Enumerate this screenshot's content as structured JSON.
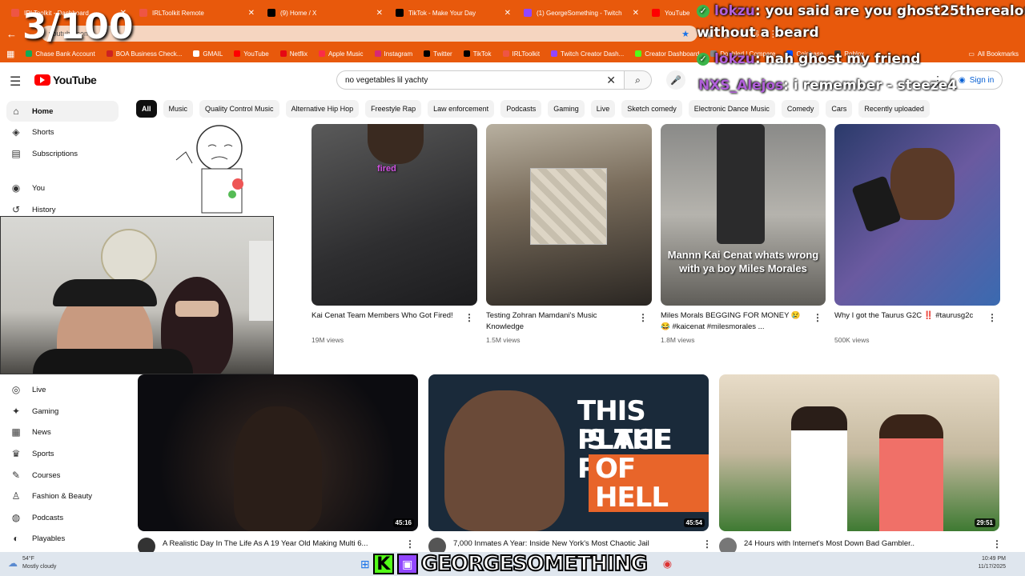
{
  "overlay": {
    "counter": "3/100"
  },
  "tabs": [
    {
      "label": "IRLToolkit - Dashboard",
      "color": "#e54"
    },
    {
      "label": "IRLToolkit Remote",
      "color": "#e54"
    },
    {
      "label": "(9) Home / X",
      "color": "#000"
    },
    {
      "label": "TikTok - Make Your Day",
      "color": "#000"
    },
    {
      "label": "(1) GeorgeSomething - Twitch",
      "color": "#9146ff"
    },
    {
      "label": "YouTube",
      "color": "#f00"
    }
  ],
  "address": {
    "url": "youtube.com"
  },
  "bookmarks": [
    {
      "label": "Chase Bank Account",
      "color": "#1a5"
    },
    {
      "label": "BOA Business Check...",
      "color": "#c22"
    },
    {
      "label": "GMAIL",
      "color": "#fff"
    },
    {
      "label": "YouTube",
      "color": "#f00"
    },
    {
      "label": "Netflix",
      "color": "#e50914"
    },
    {
      "label": "Apple Music",
      "color": "#fa2d48"
    },
    {
      "label": "Instagram",
      "color": "#d62976"
    },
    {
      "label": "Twitter",
      "color": "#000"
    },
    {
      "label": "TikTok",
      "color": "#000"
    },
    {
      "label": "IRLToolkit",
      "color": "#e54"
    },
    {
      "label": "Twitch Creator Dash...",
      "color": "#9146ff"
    },
    {
      "label": "Creator Dashboard",
      "color": "#53fc18"
    },
    {
      "label": "Doubled | Compare",
      "color": "#888"
    },
    {
      "label": "Coinbase",
      "color": "#0052ff"
    },
    {
      "label": "Roblox",
      "color": "#444"
    }
  ],
  "all_bookmarks": "All Bookmarks",
  "chat": [
    {
      "user": "lokzu",
      "text": ": you said are you ghost25therealone"
    },
    {
      "user": "",
      "text": "without a beard"
    },
    {
      "user": "lokzu",
      "text": ": nah ghost my friend"
    },
    {
      "user": "NXS_Alejos",
      "text": ": i remember - steeze4"
    }
  ],
  "youtube": {
    "logo": "YouTube",
    "search_query": "no vegetables lil yachty",
    "signin": "Sign in"
  },
  "chips": [
    "All",
    "Music",
    "Quality Control Music",
    "Alternative Hip Hop",
    "Freestyle Rap",
    "Law enforcement",
    "Podcasts",
    "Gaming",
    "Live",
    "Sketch comedy",
    "Electronic Dance Music",
    "Comedy",
    "Cars",
    "Recently uploaded"
  ],
  "sidebar": [
    {
      "label": "Home",
      "icon": "⌂"
    },
    {
      "label": "Shorts",
      "icon": "◈"
    },
    {
      "label": "Subscriptions",
      "icon": "▤"
    },
    {
      "label": "You",
      "icon": "◉"
    },
    {
      "label": "History",
      "icon": "↺"
    },
    {
      "label": "Live",
      "icon": "◎"
    },
    {
      "label": "Gaming",
      "icon": "✦"
    },
    {
      "label": "News",
      "icon": "▦"
    },
    {
      "label": "Sports",
      "icon": "🏆"
    },
    {
      "label": "Courses",
      "icon": "✎"
    },
    {
      "label": "Fashion & Beauty",
      "icon": "♙"
    },
    {
      "label": "Podcasts",
      "icon": "◍"
    },
    {
      "label": "Playables",
      "icon": "◐"
    }
  ],
  "videos_row1": [
    {
      "title": "Kai Cenat Team Members Who Got Fired!",
      "views": "19M views",
      "caption": "fired"
    },
    {
      "title": "Testing Zohran Mamdani's Music Knowledge",
      "views": "1.5M views",
      "caption": ""
    },
    {
      "title": "Miles Morals BEGGING FOR MONEY 😢😂 #kaicenat #milesmorales ...",
      "views": "1.8M views",
      "caption": "Mannn Kai Cenat whats wrong with ya boy Miles Morales"
    },
    {
      "title": "Why I got the Taurus G2C ‼️ #taurusg2c",
      "views": "500K views",
      "caption": ""
    }
  ],
  "videos_row2": [
    {
      "title": "A Realistic Day In The Life As A 19 Year Old Making Multi 6...",
      "duration": "45:16"
    },
    {
      "title": "7,000 Inmates A Year: Inside New York's Most Chaotic Jail",
      "duration": "45:54",
      "thumb_text_1": "THIS PLACE",
      "thumb_text_2": "IS THE PITS",
      "thumb_text_3": "OF HELL"
    },
    {
      "title": "24 Hours with Internet's Most Down Bad Gambler..",
      "duration": "29:51"
    }
  ],
  "taskbar": {
    "temp": "54°F",
    "weather": "Mostly cloudy",
    "streamer": "GEORGESOMETHING",
    "time": "10:49 PM",
    "date": "11/17/2025"
  }
}
